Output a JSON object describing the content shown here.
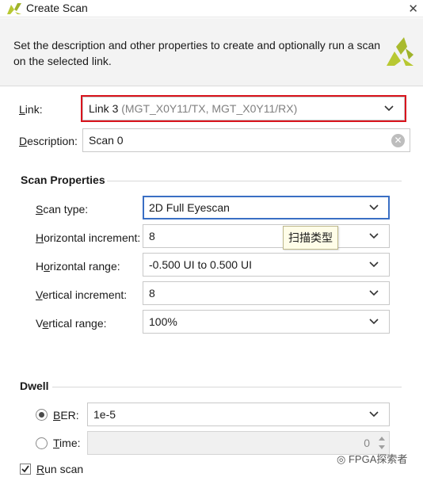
{
  "window": {
    "title": "Create Scan"
  },
  "header": {
    "description": "Set the description and other properties to create and optionally run a scan on the selected link."
  },
  "link": {
    "label": "Link:",
    "value_main": "Link 3",
    "value_detail": "(MGT_X0Y11/TX, MGT_X0Y11/RX)"
  },
  "description_field": {
    "label": "Description:",
    "value": "Scan 0"
  },
  "scan_properties": {
    "title": "Scan Properties",
    "scan_type": {
      "label": "Scan type:",
      "value": "2D Full Eyescan"
    },
    "horizontal_increment": {
      "label": "Horizontal increment:",
      "value": "8"
    },
    "horizontal_range": {
      "label": "Horizontal range:",
      "value": "-0.500 UI to 0.500 UI"
    },
    "vertical_increment": {
      "label": "Vertical increment:",
      "value": "8"
    },
    "vertical_range": {
      "label": "Vertical range:",
      "value": "100%"
    },
    "tooltip": "扫描类型"
  },
  "dwell": {
    "title": "Dwell",
    "ber": {
      "label": "BER:",
      "value": "1e-5",
      "selected": true
    },
    "time": {
      "label": "Time:",
      "value": "0",
      "selected": false
    }
  },
  "run_scan": {
    "label": "Run scan",
    "checked": true
  },
  "watermark": "FPGA探索者",
  "colors": {
    "highlight": "#d9141d",
    "focus": "#3a6fc4",
    "logo": "#b8c832"
  }
}
